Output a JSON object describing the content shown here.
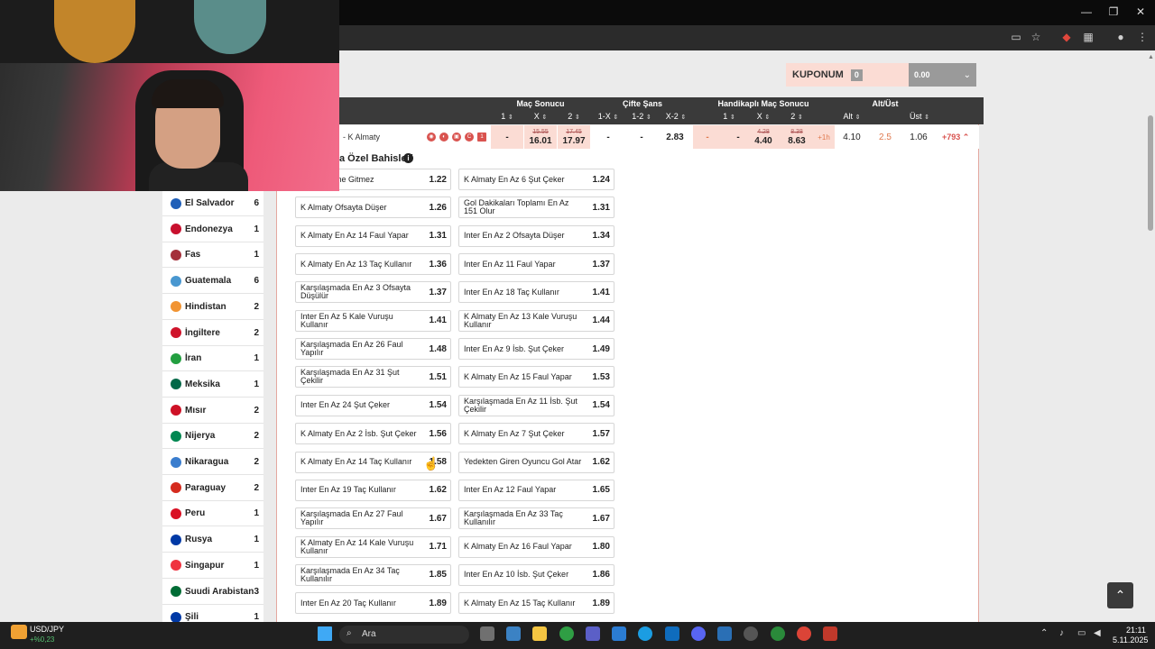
{
  "browser": {
    "minimize": "—",
    "maximize": "❐",
    "close": "✕"
  },
  "coupon": {
    "title": "KUPONUM",
    "count": "0",
    "amount": "0.00"
  },
  "odds_header": {
    "groups": [
      "Maç Sonucu",
      "Çifte Şans",
      "Handikaplı Maç Sonucu",
      "Alt/Üst"
    ],
    "ms_cols": [
      "1",
      "X",
      "2"
    ],
    "cs_cols": [
      "1-X",
      "1-2",
      "X-2"
    ],
    "hms_cols": [
      "1",
      "X",
      "2"
    ],
    "au_cols": [
      "Alt",
      "Üst"
    ]
  },
  "match": {
    "name": "- K Almaty",
    "ms1": "-",
    "msx_old": "15.55",
    "msx_new": "16.01",
    "ms2_old": "17.45",
    "ms2_new": "17.97",
    "cs1x": "-",
    "cs12": "-",
    "csx2": "2.83",
    "h1": "-",
    "h1b": "-",
    "hx_old": "4.28",
    "hx_new": "4.40",
    "h2_old": "8.38",
    "h2_new": "8.63",
    "handicap_tag": "+1h",
    "alt_line": "4.10",
    "au_line": "2.5",
    "ust": "1.06",
    "more": "+793"
  },
  "section": {
    "title": "a Özel Bahisleri"
  },
  "countries": [
    {
      "name": "El Salvador",
      "count": "6",
      "color": "#1f5fb8"
    },
    {
      "name": "Endonezya",
      "count": "1",
      "color": "#c8102e"
    },
    {
      "name": "Fas",
      "count": "1",
      "color": "#a4303a"
    },
    {
      "name": "Guatemala",
      "count": "6",
      "color": "#4997d0"
    },
    {
      "name": "Hindistan",
      "count": "2",
      "color": "#f19433"
    },
    {
      "name": "İngiltere",
      "count": "2",
      "color": "#cf142b"
    },
    {
      "name": "İran",
      "count": "1",
      "color": "#239f40"
    },
    {
      "name": "Meksika",
      "count": "1",
      "color": "#006847"
    },
    {
      "name": "Mısır",
      "count": "2",
      "color": "#ce1126"
    },
    {
      "name": "Nijerya",
      "count": "2",
      "color": "#008751"
    },
    {
      "name": "Nikaragua",
      "count": "2",
      "color": "#3a7dce"
    },
    {
      "name": "Paraguay",
      "count": "2",
      "color": "#d52b1e"
    },
    {
      "name": "Peru",
      "count": "1",
      "color": "#d91023"
    },
    {
      "name": "Rusya",
      "count": "1",
      "color": "#0039a6"
    },
    {
      "name": "Singapur",
      "count": "1",
      "color": "#ef3340"
    },
    {
      "name": "Suudi Arabistan",
      "count": "3",
      "color": "#006c35"
    },
    {
      "name": "Şili",
      "count": "1",
      "color": "#0039a6"
    }
  ],
  "bets_left": [
    {
      "label": "r Monitörüne Gitmez",
      "odd": "1.22"
    },
    {
      "label": "K Almaty Ofsayta Düşer",
      "odd": "1.26"
    },
    {
      "label": "K Almaty En Az 14 Faul Yapar",
      "odd": "1.31"
    },
    {
      "label": "K Almaty En Az 13 Taç Kullanır",
      "odd": "1.36"
    },
    {
      "label": "Karşılaşmada En Az 3 Ofsayta Düşülür",
      "odd": "1.37"
    },
    {
      "label": "Inter En Az 5 Kale Vuruşu Kullanır",
      "odd": "1.41"
    },
    {
      "label": "Karşılaşmada En Az 26 Faul Yapılır",
      "odd": "1.48"
    },
    {
      "label": "Karşılaşmada En Az 31 Şut Çekilir",
      "odd": "1.51"
    },
    {
      "label": "Inter En Az 24 Şut Çeker",
      "odd": "1.54"
    },
    {
      "label": "K Almaty En Az 2 İsb. Şut Çeker",
      "odd": "1.56"
    },
    {
      "label": "K Almaty En Az 14 Taç Kullanır",
      "odd": "1.58"
    },
    {
      "label": "Inter En Az 19 Taç Kullanır",
      "odd": "1.62"
    },
    {
      "label": "Karşılaşmada En Az 27 Faul Yapılır",
      "odd": "1.67"
    },
    {
      "label": "K Almaty En Az 14 Kale Vuruşu Kullanır",
      "odd": "1.71"
    },
    {
      "label": "Karşılaşmada En Az 34 Taç Kullanılır",
      "odd": "1.85"
    },
    {
      "label": "Inter En Az 20 Taç Kullanır",
      "odd": "1.89"
    }
  ],
  "bets_right": [
    {
      "label": "K Almaty En Az 6 Şut Çeker",
      "odd": "1.24"
    },
    {
      "label": "Gol Dakikaları Toplamı En Az 151 Olur",
      "odd": "1.31"
    },
    {
      "label": "Inter En Az 2 Ofsayta Düşer",
      "odd": "1.34"
    },
    {
      "label": "Inter En Az 11 Faul Yapar",
      "odd": "1.37"
    },
    {
      "label": "Inter En Az 18 Taç Kullanır",
      "odd": "1.41"
    },
    {
      "label": "K Almaty En Az 13 Kale Vuruşu Kullanır",
      "odd": "1.44"
    },
    {
      "label": "Inter En Az 9 İsb. Şut Çeker",
      "odd": "1.49"
    },
    {
      "label": "K Almaty En Az 15 Faul Yapar",
      "odd": "1.53"
    },
    {
      "label": "Karşılaşmada En Az 11 İsb. Şut Çekilir",
      "odd": "1.54"
    },
    {
      "label": "K Almaty En Az 7 Şut Çeker",
      "odd": "1.57"
    },
    {
      "label": "Yedekten Giren Oyuncu Gol Atar",
      "odd": "1.62"
    },
    {
      "label": "Inter En Az 12 Faul Yapar",
      "odd": "1.65"
    },
    {
      "label": "Karşılaşmada En Az 33 Taç Kullanılır",
      "odd": "1.67"
    },
    {
      "label": "K Almaty En Az 16 Faul Yapar",
      "odd": "1.80"
    },
    {
      "label": "Inter En Az 10 İsb. Şut Çeker",
      "odd": "1.86"
    },
    {
      "label": "K Almaty En Az 15 Taç Kullanır",
      "odd": "1.89"
    }
  ],
  "taskbar": {
    "widget_title": "USD/JPY",
    "widget_sub": "+%0,23",
    "search_placeholder": "Ara",
    "time": "21:11",
    "date": "5.11.2025"
  }
}
